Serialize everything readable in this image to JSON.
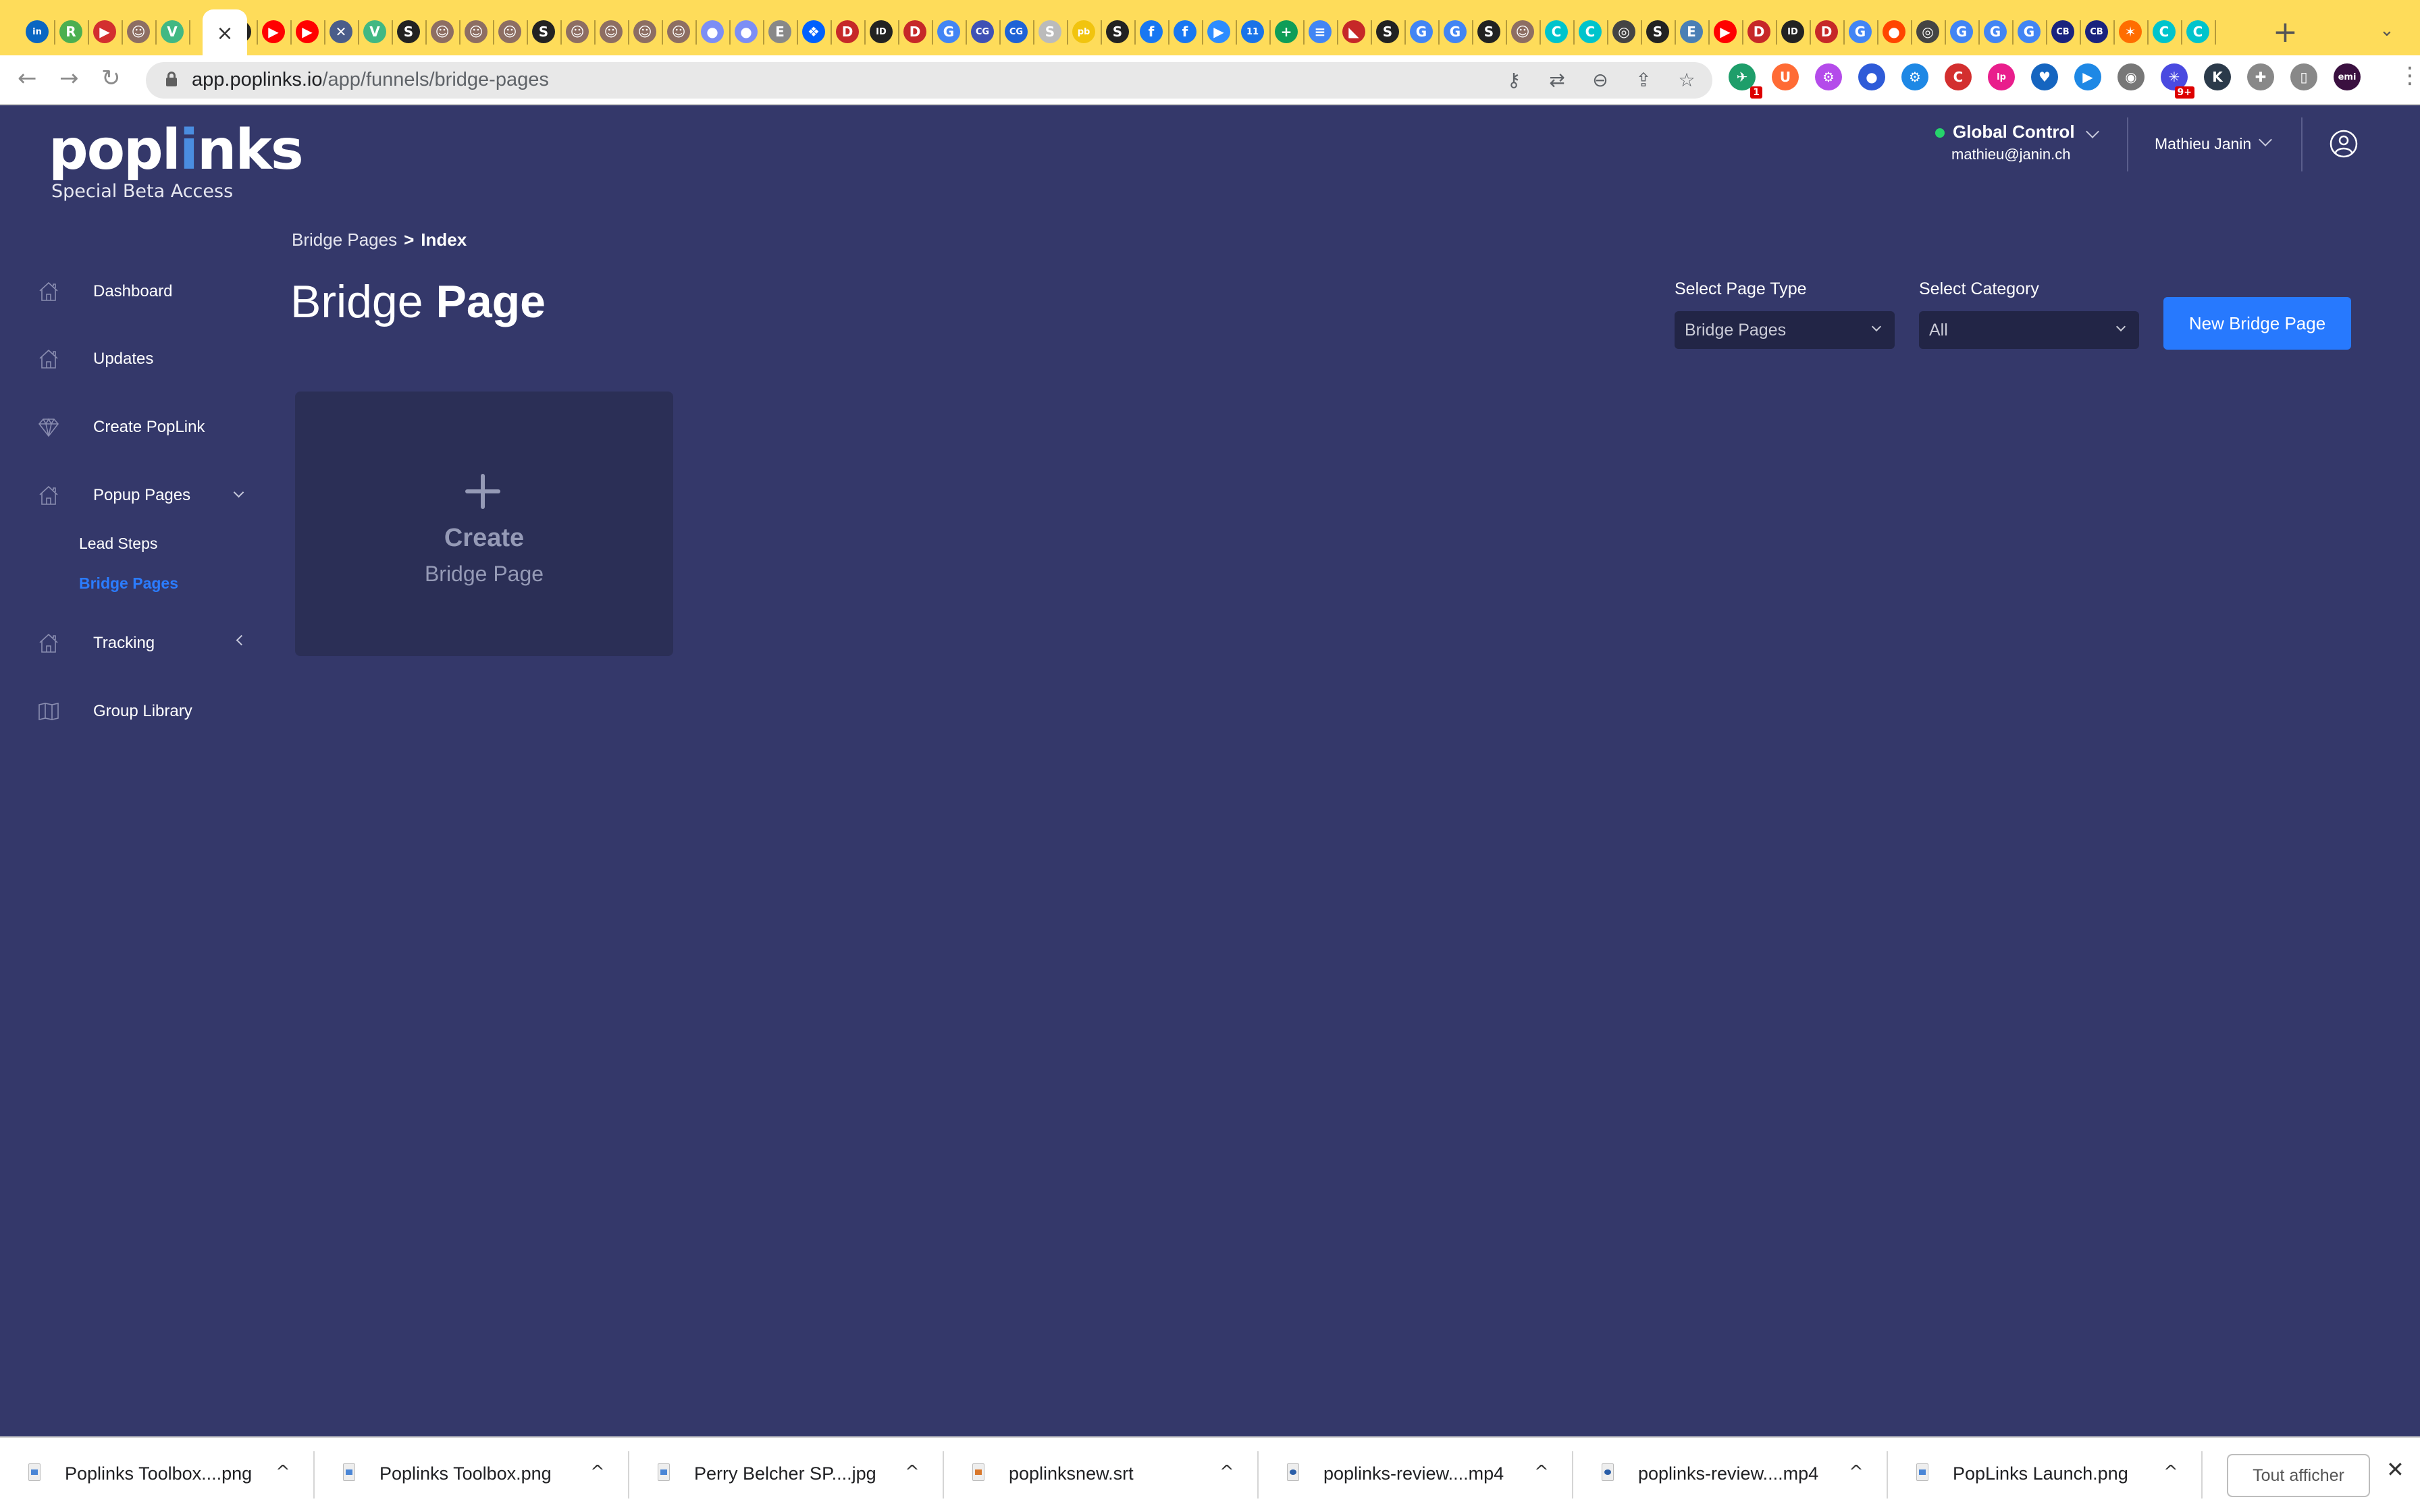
{
  "browser": {
    "active_tab_close": "×",
    "new_tab": "+",
    "tab_menu": "⌄",
    "tab_favicons": [
      {
        "name": "linkedin",
        "glyph": "in",
        "color": "#0a66c2"
      },
      {
        "name": "rytr",
        "glyph": "R",
        "color": "#4caf50"
      },
      {
        "name": "red-app",
        "glyph": "▶",
        "color": "#d32f2f"
      },
      {
        "name": "avatar",
        "glyph": "☺",
        "color": "#8d6e63"
      },
      {
        "name": "vue",
        "glyph": "V",
        "color": "#41b883"
      },
      {
        "name": "active-tab",
        "glyph": "",
        "color": ""
      },
      {
        "name": "globe",
        "glyph": "S",
        "color": "#222"
      },
      {
        "name": "youtube",
        "glyph": "▶",
        "color": "#ff0000"
      },
      {
        "name": "youtube",
        "glyph": "▶",
        "color": "#ff0000"
      },
      {
        "name": "tools",
        "glyph": "✕",
        "color": "#4a5d8a"
      },
      {
        "name": "vue",
        "glyph": "V",
        "color": "#41b883"
      },
      {
        "name": "globe",
        "glyph": "S",
        "color": "#222"
      },
      {
        "name": "avatar",
        "glyph": "☺",
        "color": "#8d6e63"
      },
      {
        "name": "avatar",
        "glyph": "☺",
        "color": "#8d6e63"
      },
      {
        "name": "avatar",
        "glyph": "☺",
        "color": "#8d6e63"
      },
      {
        "name": "globe",
        "glyph": "S",
        "color": "#222"
      },
      {
        "name": "avatar",
        "glyph": "☺",
        "color": "#8d6e63"
      },
      {
        "name": "avatar",
        "glyph": "☺",
        "color": "#8d6e63"
      },
      {
        "name": "avatar",
        "glyph": "☺",
        "color": "#8d6e63"
      },
      {
        "name": "avatar",
        "glyph": "☺",
        "color": "#8d6e63"
      },
      {
        "name": "bubble",
        "glyph": "●",
        "color": "#7c8ef5"
      },
      {
        "name": "bubble",
        "glyph": "●",
        "color": "#7c8ef5"
      },
      {
        "name": "text-e",
        "glyph": "E",
        "color": "#888"
      },
      {
        "name": "dropbox",
        "glyph": "❖",
        "color": "#0061fe"
      },
      {
        "name": "app-d",
        "glyph": "D",
        "color": "#c62828"
      },
      {
        "name": "app-id",
        "glyph": "ID",
        "color": "#222"
      },
      {
        "name": "app-d",
        "glyph": "D",
        "color": "#c62828"
      },
      {
        "name": "google",
        "glyph": "G",
        "color": "#4285f4"
      },
      {
        "name": "cg",
        "glyph": "CG",
        "color": "#3f51b5"
      },
      {
        "name": "cg",
        "glyph": "CG",
        "color": "#1e63d6"
      },
      {
        "name": "globe-gray",
        "glyph": "S",
        "color": "#bbb"
      },
      {
        "name": "pb",
        "glyph": "pb",
        "color": "#f1c40f"
      },
      {
        "name": "globe",
        "glyph": "S",
        "color": "#222"
      },
      {
        "name": "facebook",
        "glyph": "f",
        "color": "#1877f2"
      },
      {
        "name": "facebook",
        "glyph": "f",
        "color": "#1877f2"
      },
      {
        "name": "zoom",
        "glyph": "▶",
        "color": "#2d8cff"
      },
      {
        "name": "calendar",
        "glyph": "11",
        "color": "#1a73e8"
      },
      {
        "name": "sheets",
        "glyph": "+",
        "color": "#0f9d58"
      },
      {
        "name": "docs",
        "glyph": "≡",
        "color": "#4285f4"
      },
      {
        "name": "red-flag",
        "glyph": "◣",
        "color": "#c62828"
      },
      {
        "name": "globe",
        "glyph": "S",
        "color": "#222"
      },
      {
        "name": "google",
        "glyph": "G",
        "color": "#4285f4"
      },
      {
        "name": "google",
        "glyph": "G",
        "color": "#4285f4"
      },
      {
        "name": "globe",
        "glyph": "S",
        "color": "#222"
      },
      {
        "name": "avatar",
        "glyph": "☺",
        "color": "#8d6e63"
      },
      {
        "name": "canva",
        "glyph": "C",
        "color": "#00c4cc"
      },
      {
        "name": "canva",
        "glyph": "C",
        "color": "#00c4cc"
      },
      {
        "name": "chrome",
        "glyph": "◎",
        "color": "#444"
      },
      {
        "name": "globe",
        "glyph": "S",
        "color": "#222"
      },
      {
        "name": "easyl",
        "glyph": "E",
        "color": "#4a7fb5"
      },
      {
        "name": "youtube",
        "glyph": "▶",
        "color": "#ff0000"
      },
      {
        "name": "app-d",
        "glyph": "D",
        "color": "#c62828"
      },
      {
        "name": "app-id",
        "glyph": "ID",
        "color": "#222"
      },
      {
        "name": "app-d",
        "glyph": "D",
        "color": "#c62828"
      },
      {
        "name": "google",
        "glyph": "G",
        "color": "#4285f4"
      },
      {
        "name": "reddit",
        "glyph": "●",
        "color": "#ff4500"
      },
      {
        "name": "chrome",
        "glyph": "◎",
        "color": "#444"
      },
      {
        "name": "google",
        "glyph": "G",
        "color": "#4285f4"
      },
      {
        "name": "google",
        "glyph": "G",
        "color": "#4285f4"
      },
      {
        "name": "google",
        "glyph": "G",
        "color": "#4285f4"
      },
      {
        "name": "cb",
        "glyph": "CB",
        "color": "#1a237e"
      },
      {
        "name": "cb",
        "glyph": "CB",
        "color": "#1a237e"
      },
      {
        "name": "spark",
        "glyph": "✶",
        "color": "#ff6d00"
      },
      {
        "name": "canva",
        "glyph": "C",
        "color": "#00c4cc"
      },
      {
        "name": "canva",
        "glyph": "C",
        "color": "#00c4cc"
      }
    ],
    "url_host": "app.poplinks.io",
    "url_path": "/app/funnels/bridge-pages",
    "extensions": [
      {
        "name": "ext-green",
        "glyph": "✈",
        "color": "#1e9e6a",
        "badge": "1"
      },
      {
        "name": "ext-u",
        "glyph": "U",
        "color": "#ff6b35",
        "badge": ""
      },
      {
        "name": "ext-purple",
        "glyph": "⚙",
        "color": "#b44bea",
        "badge": ""
      },
      {
        "name": "ext-alien",
        "glyph": "●",
        "color": "#2e5bd8",
        "badge": ""
      },
      {
        "name": "ext-share",
        "glyph": "⚙",
        "color": "#1e88e5",
        "badge": ""
      },
      {
        "name": "ext-c",
        "glyph": "C",
        "color": "#d32f2f",
        "badge": ""
      },
      {
        "name": "ext-lp",
        "glyph": "lp",
        "color": "#e91e8c",
        "badge": ""
      },
      {
        "name": "ext-heart",
        "glyph": "♥",
        "color": "#1565c0",
        "badge": ""
      },
      {
        "name": "ext-play",
        "glyph": "▶",
        "color": "#1e88e5",
        "badge": ""
      },
      {
        "name": "ext-film",
        "glyph": "◉",
        "color": "#777",
        "badge": ""
      },
      {
        "name": "ext-spark",
        "glyph": "✳",
        "color": "#4a4ae0",
        "badge": "9+"
      },
      {
        "name": "ext-k",
        "glyph": "K",
        "color": "#2b3a4a",
        "badge": ""
      },
      {
        "name": "extensions-puzzle",
        "glyph": "✚",
        "color": "#888",
        "badge": ""
      },
      {
        "name": "side-panel",
        "glyph": "▯",
        "color": "#888",
        "badge": ""
      },
      {
        "name": "profile-emi",
        "glyph": "emi",
        "color": "#3a1040",
        "badge": ""
      }
    ]
  },
  "app": {
    "logo": {
      "pre": "popl",
      "accent": "i",
      "post": "nks",
      "subtitle": "Special Beta Access"
    },
    "header": {
      "account_title": "Global Control",
      "account_email": "mathieu@janin.ch",
      "status_color": "#26d36b",
      "user_name": "Mathieu Janin"
    },
    "sidebar": {
      "items": [
        {
          "label": "Dashboard",
          "icon": "home"
        },
        {
          "label": "Updates",
          "icon": "home"
        },
        {
          "label": "Create PopLink",
          "icon": "diamond"
        },
        {
          "label": "Popup Pages",
          "icon": "home",
          "caret": "down"
        },
        {
          "label": "Tracking",
          "icon": "home",
          "caret": "left"
        },
        {
          "label": "Group Library",
          "icon": "map"
        }
      ],
      "sub_items": [
        {
          "label": "Lead Steps",
          "active": false
        },
        {
          "label": "Bridge Pages",
          "active": true
        }
      ]
    },
    "breadcrumb": {
      "parent": "Bridge Pages",
      "separator": ">",
      "current": "Index"
    },
    "title": {
      "light": "Bridge",
      "bold": "Page"
    },
    "filters": {
      "page_type_label": "Select Page Type",
      "page_type_value": "Bridge Pages",
      "category_label": "Select Category",
      "category_value": "All"
    },
    "new_button": "New Bridge Page",
    "create_card": {
      "title": "Create",
      "subtitle": "Bridge Page"
    },
    "accent_color": "#2779fe"
  },
  "downloads": {
    "items": [
      {
        "name": "Poplinks Toolbox....png",
        "type": "png"
      },
      {
        "name": "Poplinks Toolbox.png",
        "type": "png"
      },
      {
        "name": "Perry Belcher SP....jpg",
        "type": "jpg"
      },
      {
        "name": "poplinksnew.srt",
        "type": "srt"
      },
      {
        "name": "poplinks-review....mp4",
        "type": "mp4"
      },
      {
        "name": "poplinks-review....mp4",
        "type": "mp4"
      },
      {
        "name": "PopLinks Launch.png",
        "type": "png"
      }
    ],
    "show_all": "Tout afficher",
    "close": "✕"
  }
}
